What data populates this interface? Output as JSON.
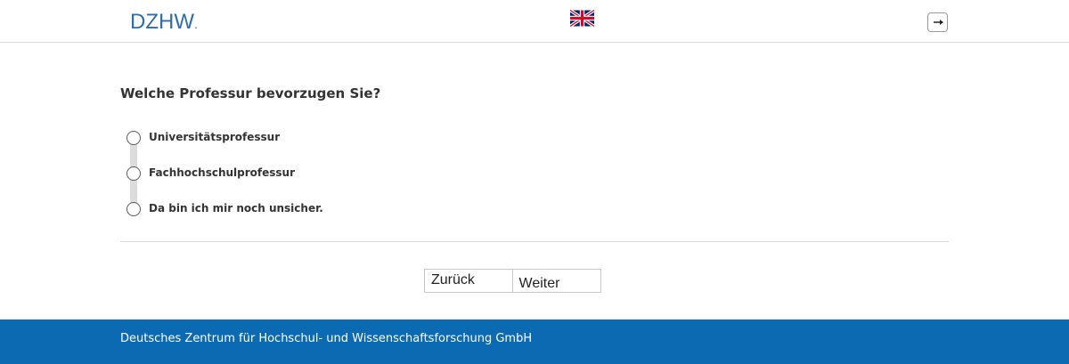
{
  "header": {
    "logo_text": "DZHW",
    "logo_dot": ".",
    "language_icon": "uk-flag-icon",
    "exit_icon": "exit-icon"
  },
  "question": {
    "text": "Welche Professur bevorzugen Sie?",
    "options": [
      {
        "label": "Universitätsprofessur",
        "selected": false
      },
      {
        "label": "Fachhochschulprofessur",
        "selected": false
      },
      {
        "label": "Da bin ich mir noch unsicher.",
        "selected": false
      }
    ]
  },
  "navigation": {
    "back_label": "Zurück",
    "next_label": "Weiter"
  },
  "footer": {
    "text": "Deutsches Zentrum für Hochschul- und Wissenschaftsforschung GmbH"
  },
  "colors": {
    "brand_blue": "#0c6ab3",
    "logo_blue": "#2f6eaa"
  }
}
